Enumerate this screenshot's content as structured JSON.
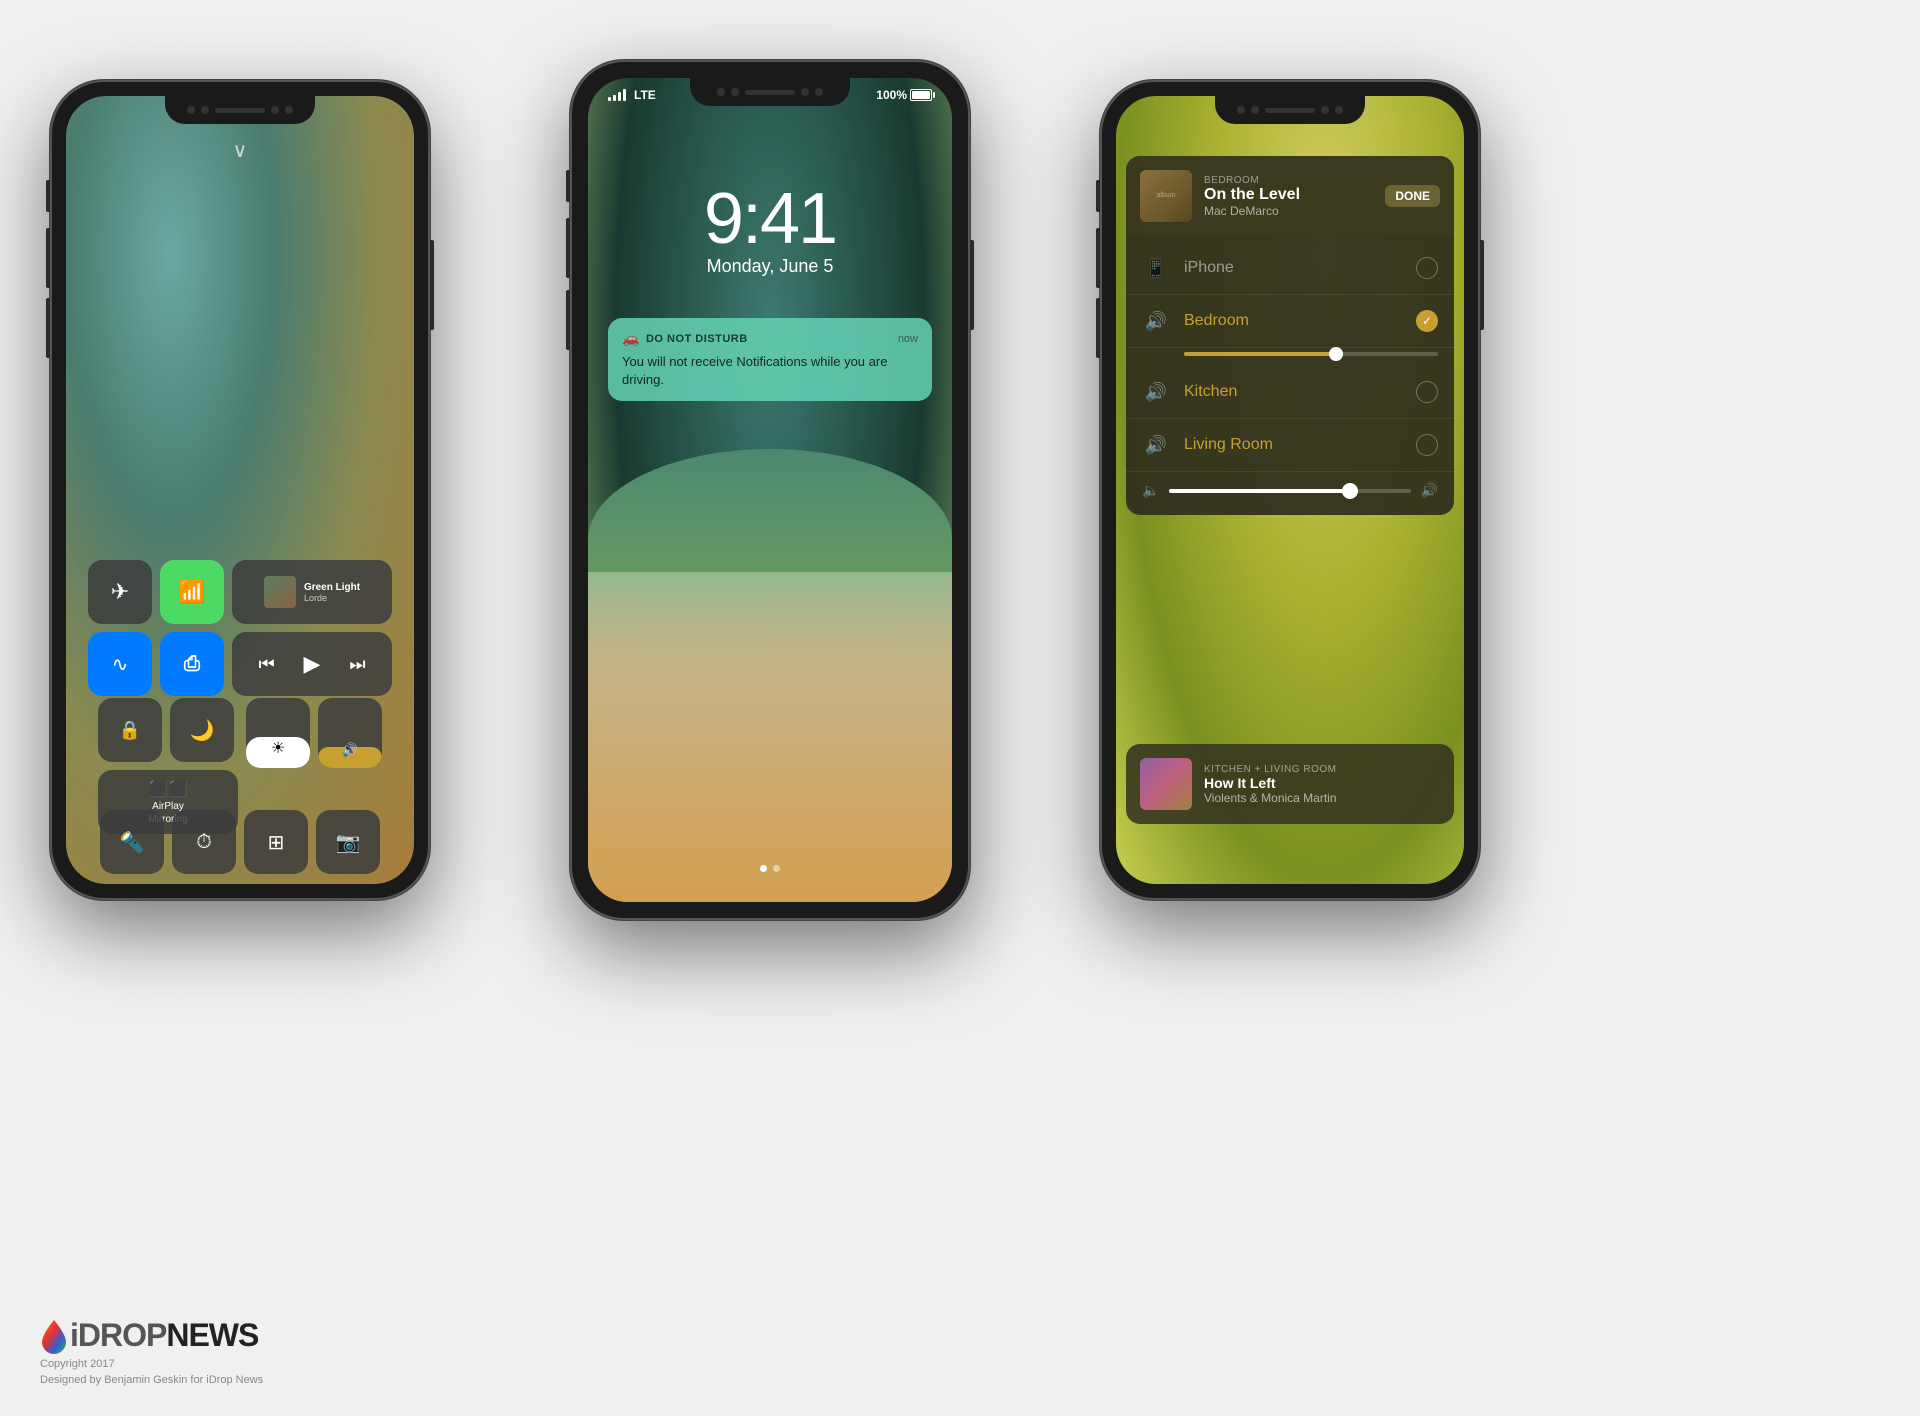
{
  "phone1": {
    "label": "Control Center Phone",
    "swipe_hint": "∨",
    "music": {
      "song": "Green Light",
      "artist": "Lorde"
    },
    "tiles": {
      "airplane": "✈",
      "cellular": "📶",
      "wifi": "wifi",
      "bluetooth": "bluetooth",
      "lock_rotation": "🔒",
      "do_not_disturb": "🌙",
      "airplay_label": "AirPlay\nMirroring",
      "flashlight": "🔦",
      "timer": "⏱",
      "calculator": "🧮",
      "camera": "📷"
    }
  },
  "phone2": {
    "label": "Lock Screen Phone",
    "status": {
      "carrier": "LTE",
      "signal_bars": 4,
      "battery": "100%"
    },
    "time": "9:41",
    "date": "Monday, June 5",
    "notification": {
      "app": "DO NOT DISTURB",
      "time": "now",
      "body": "You will not receive Notifications while you are driving."
    },
    "page_dots": [
      1,
      2
    ]
  },
  "phone3": {
    "label": "AirPlay Phone",
    "now_playing": {
      "room": "BEDROOM",
      "song": "On the Level",
      "artist": "Mac DeMarco",
      "done_label": "DONE"
    },
    "devices": [
      {
        "name": "iPhone",
        "active": false,
        "icon": "📱"
      },
      {
        "name": "Bedroom",
        "active": true,
        "icon": "🔊"
      },
      {
        "name": "Kitchen",
        "active": false,
        "icon": "🔊"
      },
      {
        "name": "Living Room",
        "active": false,
        "icon": "🔊"
      }
    ],
    "mini_player": {
      "rooms": "KITCHEN + LIVING ROOM",
      "song": "How It Left",
      "artist": "Violents & Monica Martin"
    }
  },
  "logo": {
    "idrop": "iDROP",
    "news": "NEWS",
    "copyright": "Copyright 2017",
    "credit": "Designed by Benjamin Geskin for iDrop News"
  }
}
